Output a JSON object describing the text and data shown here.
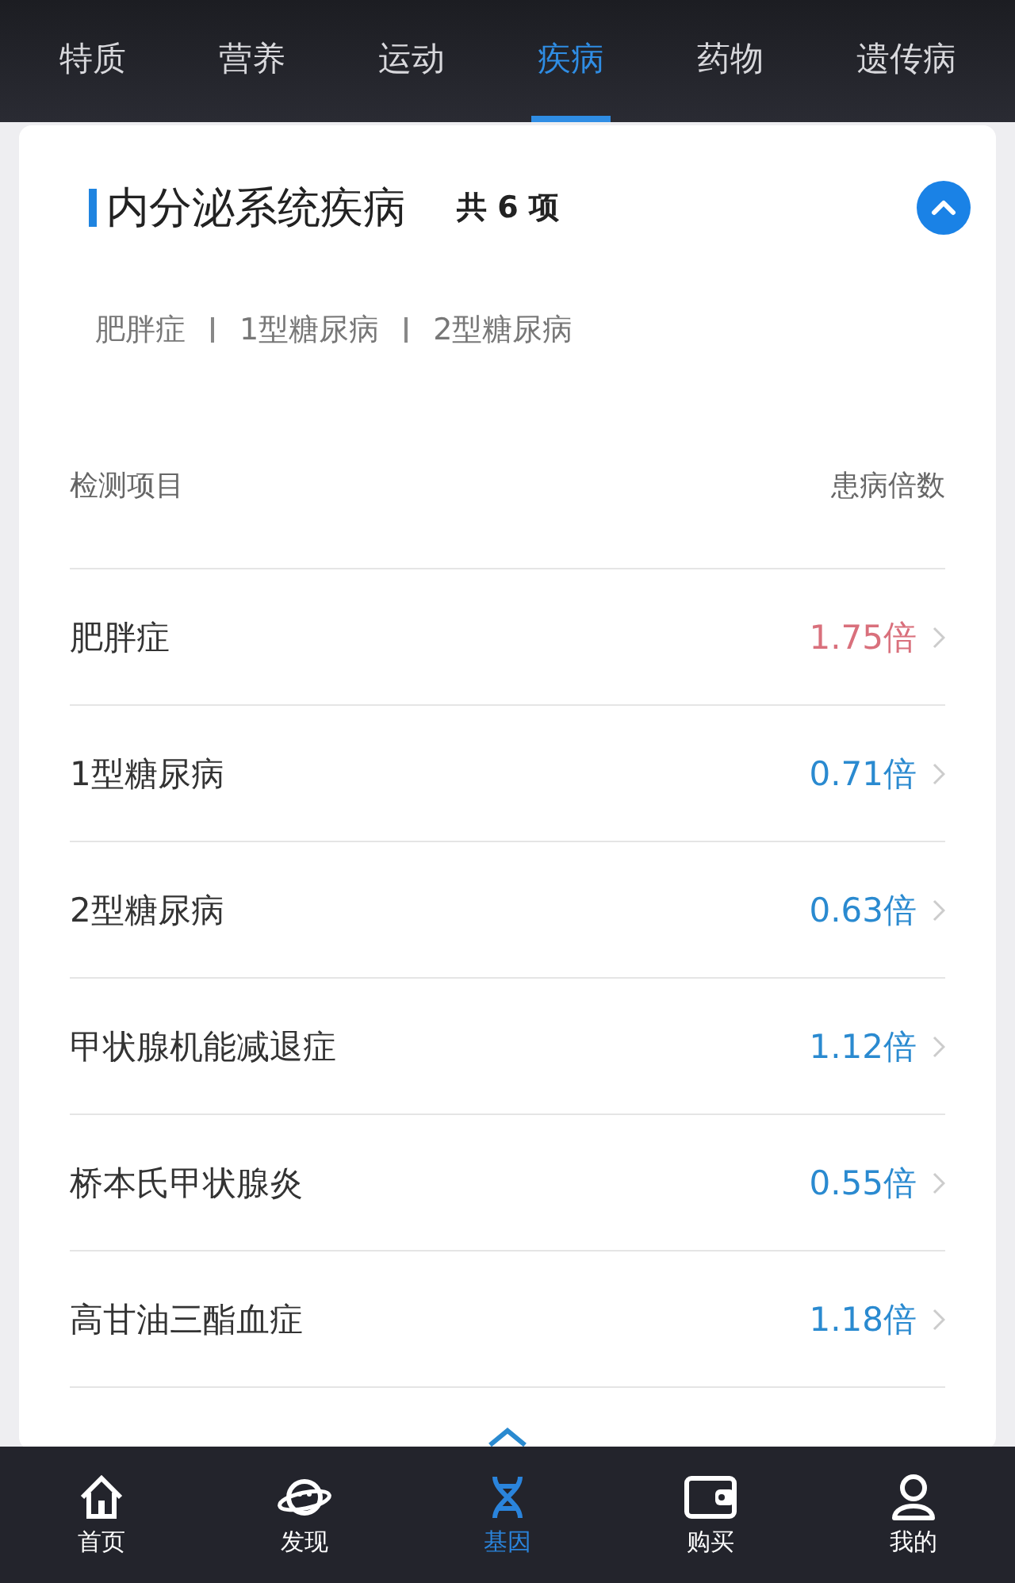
{
  "tabs": [
    {
      "label": "特质",
      "selected": false
    },
    {
      "label": "营养",
      "selected": false
    },
    {
      "label": "运动",
      "selected": false
    },
    {
      "label": "疾病",
      "selected": true
    },
    {
      "label": "药物",
      "selected": false
    },
    {
      "label": "遗传病",
      "selected": false
    }
  ],
  "section": {
    "title": "内分泌系统疾病",
    "count": "共 6 项",
    "expanded": true,
    "tags": [
      "肥胖症",
      "1型糖尿病",
      "2型糖尿病"
    ],
    "columns": [
      "检测项目",
      "患病倍数"
    ],
    "rows": [
      {
        "name": "肥胖症",
        "value": "1.75倍",
        "color": "#d9707c"
      },
      {
        "name": "1型糖尿病",
        "value": "0.71倍",
        "color": "#2a8ad0"
      },
      {
        "name": "2型糖尿病",
        "value": "0.63倍",
        "color": "#2a8ad0"
      },
      {
        "name": "甲状腺机能减退症",
        "value": "1.12倍",
        "color": "#2a8ad0"
      },
      {
        "name": "桥本氏甲状腺炎",
        "value": "0.55倍",
        "color": "#2a8ad0"
      },
      {
        "name": "高甘油三酯血症",
        "value": "1.18倍",
        "color": "#2a8ad0"
      }
    ]
  },
  "nav": [
    {
      "label": "首页",
      "kind": "home",
      "selected": false
    },
    {
      "label": "发现",
      "kind": "planet",
      "selected": false
    },
    {
      "label": "基因",
      "kind": "dna",
      "selected": true
    },
    {
      "label": "购买",
      "kind": "wallet",
      "selected": false
    },
    {
      "label": "我的",
      "kind": "user",
      "selected": false
    }
  ]
}
